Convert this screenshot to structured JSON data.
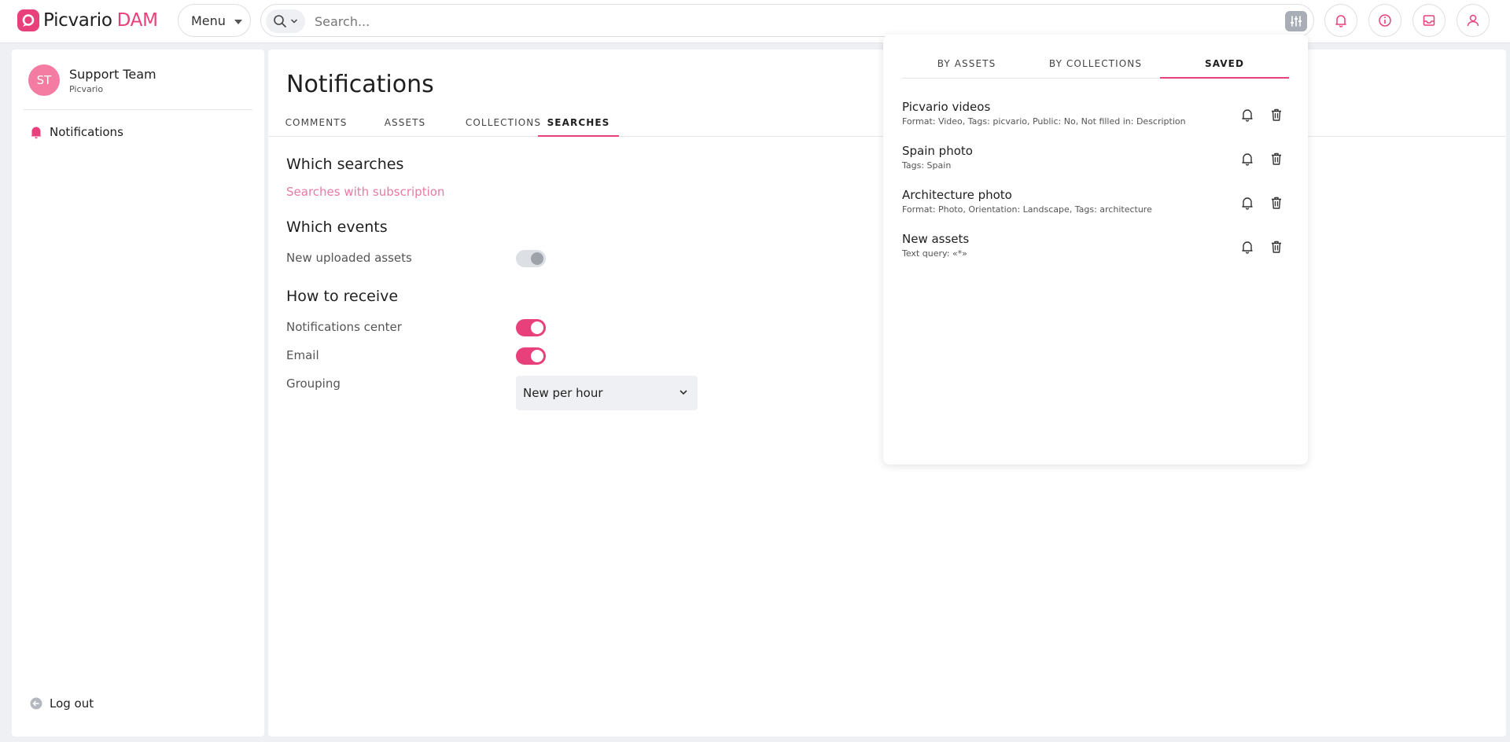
{
  "brand": {
    "name": "Picvario",
    "suffix": "DAM",
    "accent": "#e8407a"
  },
  "topbar": {
    "menu_label": "Menu",
    "search_placeholder": "Search...",
    "icons": [
      "search-icon",
      "chevron-down-icon",
      "filter-sliders-icon",
      "bell-icon",
      "info-icon",
      "inbox-icon",
      "user-icon"
    ]
  },
  "sidebar": {
    "user": {
      "initials": "ST",
      "name": "Support Team",
      "org": "Picvario"
    },
    "items": [
      {
        "label": "Notifications",
        "icon": "bell-icon",
        "active": true
      }
    ],
    "logout_label": "Log out"
  },
  "main": {
    "title": "Notifications",
    "tabs": [
      {
        "label": "COMMENTS",
        "active": false
      },
      {
        "label": "ASSETS",
        "active": false
      },
      {
        "label": "COLLECTIONS",
        "active": false
      },
      {
        "label": "SEARCHES",
        "active": true
      }
    ],
    "which_searches": {
      "heading": "Which searches",
      "link": "Searches with subscription"
    },
    "which_events": {
      "heading": "Which events",
      "options": [
        {
          "label": "New uploaded assets",
          "enabled": false
        }
      ]
    },
    "how_to_receive": {
      "heading": "How to receive",
      "options": [
        {
          "label": "Notifications center",
          "enabled": true
        },
        {
          "label": "Email",
          "enabled": true
        }
      ],
      "grouping_label": "Grouping",
      "grouping_value": "New per hour"
    }
  },
  "saved_panel": {
    "tabs": [
      {
        "label": "BY ASSETS",
        "active": false
      },
      {
        "label": "BY COLLECTIONS",
        "active": false
      },
      {
        "label": "SAVED",
        "active": true
      }
    ],
    "items": [
      {
        "name": "Picvario videos",
        "desc": "Format: Video, Tags: picvario, Public: No, Not filled in: Description"
      },
      {
        "name": "Spain photo",
        "desc": "Tags: Spain"
      },
      {
        "name": "Architecture photo",
        "desc": "Format: Photo, Orientation: Landscape, Tags: architecture"
      },
      {
        "name": "New assets",
        "desc": "Text query: «*»"
      }
    ]
  }
}
